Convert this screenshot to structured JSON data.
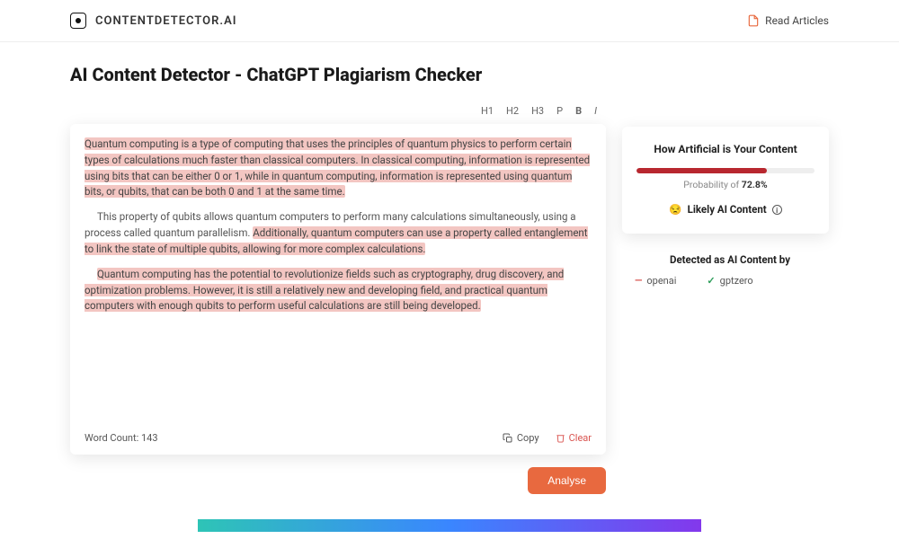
{
  "header": {
    "brand": "CONTENTDETECTOR.AI",
    "read_articles": "Read Articles"
  },
  "page_title": "AI Content Detector - ChatGPT Plagiarism Checker",
  "toolbar": {
    "h1": "H1",
    "h2": "H2",
    "h3": "H3",
    "p": "P",
    "b": "B",
    "i": "I"
  },
  "editor": {
    "paragraphs": [
      {
        "segments": [
          {
            "text": "Quantum computing is a type of computing that uses the principles of quantum physics to perform certain types of calculations much faster than classical computers. In classical computing, information is represented using bits that can be either 0 or 1, while in quantum computing, information is represented using quantum bits, or qubits, that can be both 0 and 1 at the same time.",
            "hl": true
          }
        ],
        "indent": false
      },
      {
        "segments": [
          {
            "text": "This property of qubits allows quantum computers to perform many calculations simultaneously, using a process called quantum parallelism. ",
            "hl": false
          },
          {
            "text": "Additionally, quantum computers can use a property called entanglement to link the state of multiple qubits, allowing for more complex calculations.",
            "hl": true
          }
        ],
        "indent": true
      },
      {
        "segments": [
          {
            "text": "Quantum computing has the potential to revolutionize fields such as cryptography, drug discovery, and optimization problems. However, it is still a relatively new and developing field, and practical quantum computers with enough qubits to perform useful calculations are still being developed.",
            "hl": true
          }
        ],
        "indent": true
      }
    ],
    "word_count_label": "Word Count:",
    "word_count": "143",
    "copy_label": "Copy",
    "clear_label": "Clear",
    "analyse_label": "Analyse"
  },
  "results": {
    "title": "How Artificial is Your Content",
    "probability_label": "Probability of",
    "probability_value": "72.8%",
    "probability_fill_width": "73%",
    "verdict_emoji": "😒",
    "verdict_text": "Likely AI Content",
    "detected_title": "Detected as AI Content by",
    "detectors": [
      {
        "name": "openai",
        "status": "dash"
      },
      {
        "name": "gptzero",
        "status": "check"
      }
    ]
  }
}
